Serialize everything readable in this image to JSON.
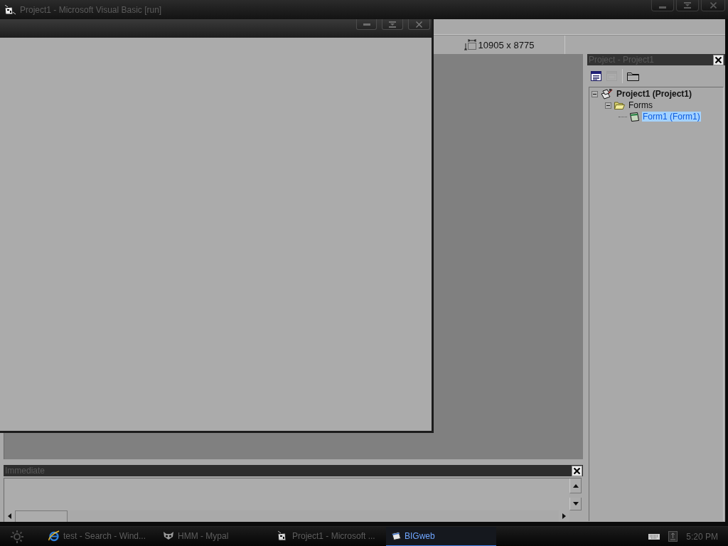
{
  "window": {
    "title": "Project1 - Microsoft Visual Basic [run]"
  },
  "toolbar": {
    "size_readout": "10905 x 8775"
  },
  "project_explorer": {
    "title": "Project - Project1",
    "toolbar": [
      {
        "kind": "code",
        "disabled": false
      },
      {
        "kind": "object",
        "disabled": true
      },
      {
        "kind": "folder",
        "disabled": false
      }
    ],
    "tree": [
      {
        "kind": "project",
        "label": "Project1 (Project1)",
        "expanded": true,
        "selected": false,
        "children": [
          {
            "kind": "folder",
            "label": "Forms",
            "expanded": true,
            "selected": false,
            "children": [
              {
                "kind": "form",
                "label": "Form1 (Form1)",
                "selected": true
              }
            ]
          }
        ]
      }
    ]
  },
  "immediate": {
    "title": "Immediate"
  },
  "taskbar": {
    "items": [
      {
        "kind": "browser",
        "label": "test - Search - Wind...",
        "selected": false
      },
      {
        "kind": "mypal",
        "label": "HMM - Mypal",
        "selected": false
      },
      {
        "kind": "vb",
        "label": "Project1 - Microsoft ...",
        "selected": false
      },
      {
        "kind": "bigweb",
        "label": "BIGweb",
        "selected": true
      }
    ],
    "clock": "5:20 PM"
  }
}
